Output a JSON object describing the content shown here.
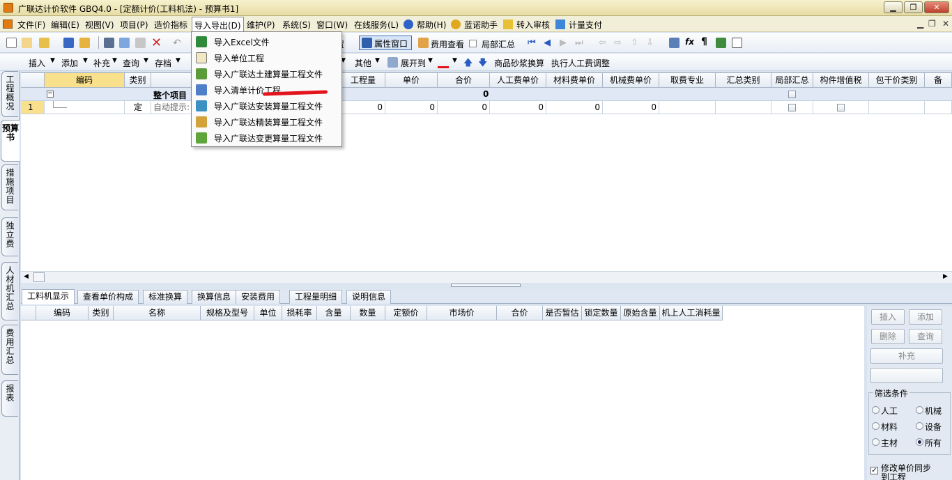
{
  "window": {
    "title": "广联达计价软件 GBQ4.0 - [定额计价(工料机法) - 预算书1]",
    "min": "▁",
    "restore": "❐",
    "close": "✕"
  },
  "menu": {
    "items": [
      "文件(F)",
      "编辑(E)",
      "视图(V)",
      "项目(P)",
      "造价指标",
      "导入导出(D)",
      "维护(P)",
      "系统(S)",
      "窗口(W)",
      "在线服务(L)",
      "帮助(H)",
      "蓝诺助手",
      "转入审核",
      "计量支付"
    ],
    "mdi": [
      "▁",
      "❐",
      "✕"
    ]
  },
  "toolbar1": {
    "shezhi": "置",
    "attr_window": "属性窗口",
    "fee_view": "费用查看",
    "local_sum": "局部汇总",
    "fx": "fx",
    "pilcrow": "¶"
  },
  "toolbar2": {
    "insert": "插入",
    "add": "添加",
    "supplement": "补充",
    "query": "查询",
    "save": "存档",
    "other": "其他",
    "expand": "展开到",
    "mortar": "商品砂浆换算",
    "labor_adjust": "执行人工费调整"
  },
  "side_tabs": [
    "工程概况",
    "预算书",
    "措施项目",
    "独立费",
    "人材机汇总",
    "费用汇总",
    "报表"
  ],
  "grid": {
    "headers": [
      "编码",
      "类别",
      "",
      "工程量",
      "单价",
      "合价",
      "人工费单价",
      "材料费单价",
      "机械费单价",
      "取费专业",
      "汇总类别",
      "局部汇总",
      "构件增值税",
      "包干价类别",
      "备"
    ],
    "group_row": {
      "name": "整个项目",
      "total": "0",
      "minus": "−"
    },
    "row1": {
      "num": "1",
      "type": "定",
      "hint": "自动提示:",
      "qty": "0",
      "price": "0",
      "total": "0",
      "labor": "0",
      "material": "0",
      "machine": "0"
    }
  },
  "import_menu": {
    "items": [
      {
        "label": "导入Excel文件",
        "icon": "excel-icon"
      },
      {
        "label": "导入单位工程",
        "icon": "unit-project-icon"
      },
      {
        "label": "导入广联达土建算量工程文件",
        "icon": "civil-quantity-icon"
      },
      {
        "label": "导入清单计价工程",
        "icon": "bill-pricing-icon"
      },
      {
        "label": "导入广联达安装算量工程文件",
        "icon": "install-quantity-icon"
      },
      {
        "label": "导入广联达精装算量工程文件",
        "icon": "decoration-quantity-icon"
      },
      {
        "label": "导入广联达变更算量工程文件",
        "icon": "change-quantity-icon"
      }
    ]
  },
  "bottom_tabs": [
    "工料机显示",
    "查看单价构成",
    "标准换算",
    "换算信息",
    "安装费用",
    "工程量明细",
    "说明信息"
  ],
  "bottom_grid": {
    "headers": [
      "编码",
      "类别",
      "名称",
      "规格及型号",
      "单位",
      "损耗率",
      "含量",
      "数量",
      "定额价",
      "市场价",
      "合价",
      "是否暂估",
      "锁定数量",
      "原始含量",
      "机上人工消耗量"
    ]
  },
  "right_panel": {
    "insert": "插入",
    "add": "添加",
    "delete": "删除",
    "query": "查询",
    "supplement": "补充",
    "filter_title": "筛选条件",
    "filters": [
      "人工",
      "机械",
      "材料",
      "设备",
      "主材",
      "所有"
    ],
    "selected": "所有",
    "sync": "修改单价同步",
    "sync2": "到工程"
  },
  "colors": {
    "title_bg": "#efe7bb",
    "menu_bg": "#f2efd9",
    "red_underline": "#e3141d",
    "grid_header": "#f9e08c"
  }
}
